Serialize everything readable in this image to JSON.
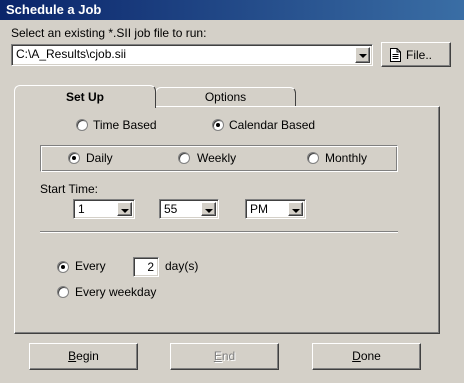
{
  "window": {
    "title": "Schedule a Job"
  },
  "job": {
    "prompt": "Select an existing *.SII job file to run:",
    "path": "C:\\A_Results\\cjob.sii",
    "file_button": "File.."
  },
  "tabs": [
    {
      "label": "Set Up",
      "active": true
    },
    {
      "label": "Options",
      "active": false
    }
  ],
  "schedule_type": {
    "options": [
      "Time Based",
      "Calendar Based"
    ],
    "selected": "Calendar Based"
  },
  "frequency": {
    "options": [
      "Daily",
      "Weekly",
      "Monthly"
    ],
    "selected": "Daily"
  },
  "start_time": {
    "label": "Start Time:",
    "hour": "1",
    "minute": "55",
    "ampm": "PM"
  },
  "recurrence": {
    "every_label": "Every",
    "every_value": "2",
    "unit": "day(s)",
    "weekday_label": "Every weekday",
    "selected": "Every"
  },
  "buttons": {
    "begin": {
      "first": "B",
      "rest": "egin"
    },
    "end": {
      "first": "E",
      "rest": "nd"
    },
    "done": {
      "first": "D",
      "rest": "one"
    }
  },
  "icons": {
    "file_button": "document-icon"
  }
}
